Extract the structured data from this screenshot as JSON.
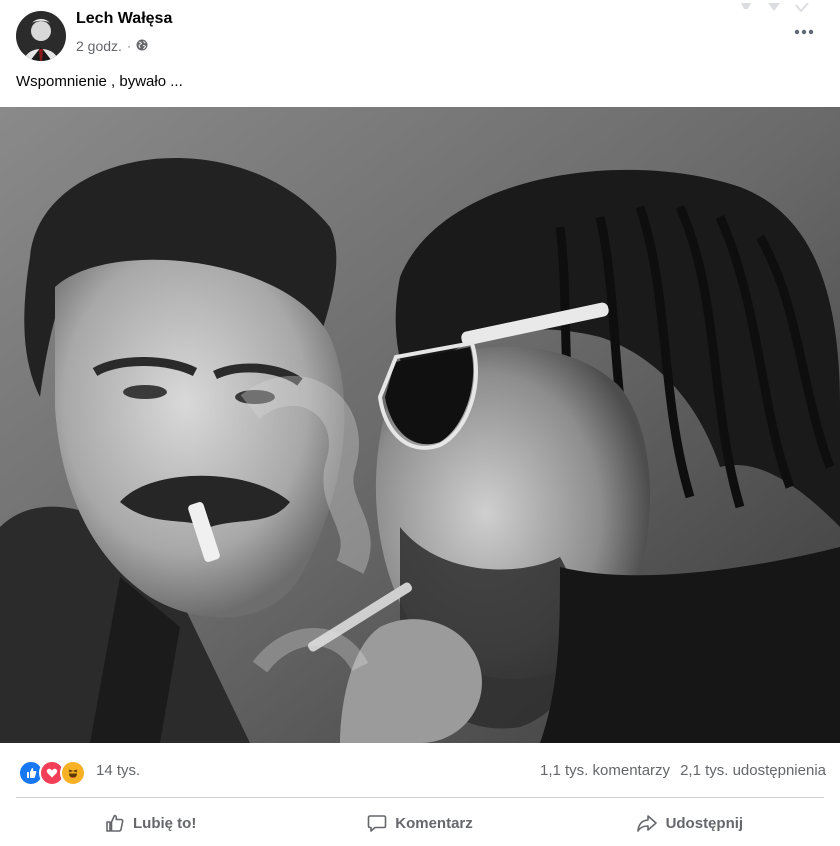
{
  "post": {
    "author": "Lech Wałęsa",
    "time": "2 godz.",
    "separator": "·",
    "text": "Wspomnienie , bywało ..."
  },
  "reactions": {
    "count": "14 tys.",
    "types": [
      "like-icon",
      "love-icon",
      "haha-icon"
    ]
  },
  "stats": {
    "comments": "1,1 tys. komentarzy",
    "shares": "2,1 tys. udostępnienia"
  },
  "actions": {
    "like": "Lubię to!",
    "comment": "Komentarz",
    "share": "Udostępnij"
  },
  "colors": {
    "like_blue": "#1877f2",
    "love_red": "#f33e58",
    "haha_yellow": "#f7b125",
    "secondary_text": "#65676b"
  }
}
